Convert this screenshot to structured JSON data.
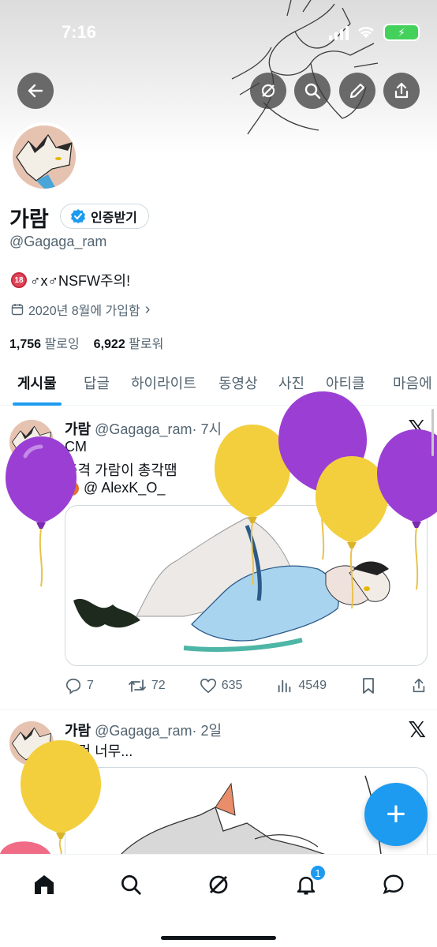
{
  "status_bar": {
    "time": "7:16"
  },
  "profile": {
    "name": "가람",
    "verify_button": "인증받기",
    "handle": "@Gagaga_ram",
    "bio_badge": "18",
    "bio": "♂x♂NSFW주의!",
    "joined": "2020년 8월에 가입함",
    "following_count": "1,756",
    "following_label": "팔로잉",
    "followers_count": "6,922",
    "followers_label": "팔로워"
  },
  "tabs": [
    "게시물",
    "답글",
    "하이라이트",
    "동영상",
    "사진",
    "아티클",
    "마음에"
  ],
  "tweets": [
    {
      "name": "가람",
      "handle": "@Gagaga_ram",
      "time": "· 7시",
      "lines": [
        "CM",
        "충격 가람이 총각땜",
        "@ AlexK_O_"
      ],
      "replies": "7",
      "retweets": "72",
      "likes": "635",
      "views": "4549"
    },
    {
      "name": "가람",
      "handle": "@Gagaga_ram",
      "time": "· 2일",
      "lines": [
        "이건 너무..."
      ]
    }
  ],
  "nav": {
    "notification_count": "1"
  },
  "colors": {
    "accent": "#1d9bf0",
    "balloon_purple": "#9b3fd4",
    "balloon_yellow": "#f3cf3e"
  }
}
